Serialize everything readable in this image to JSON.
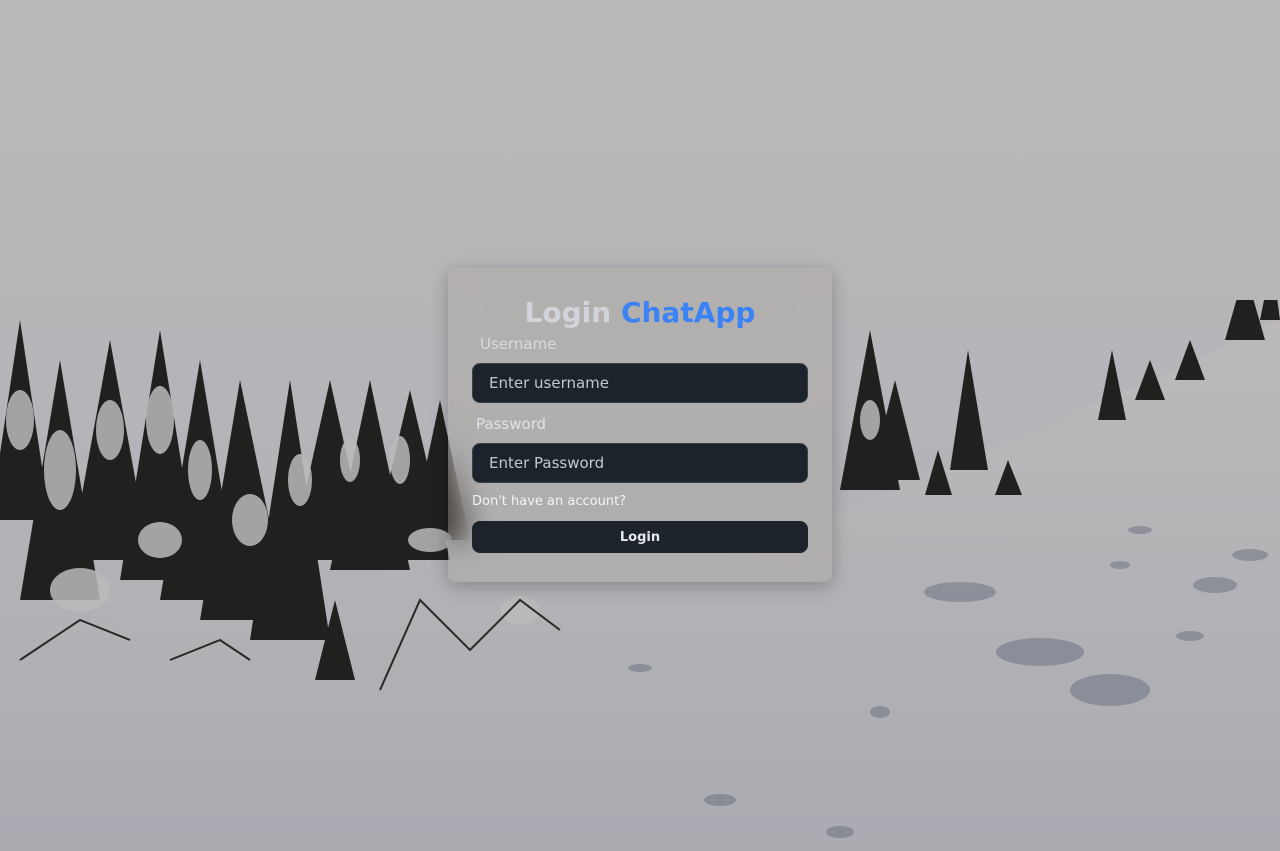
{
  "login": {
    "title_prefix": "Login",
    "title_brand": "ChatApp",
    "username_label": "Username",
    "username_placeholder": "Enter username",
    "username_value": "",
    "password_label": "Password",
    "password_placeholder": "Enter Password",
    "password_value": "",
    "signup_link": "Don't have an account?",
    "submit_label": "Login"
  },
  "colors": {
    "brand": "#3b82f6",
    "title_text": "#d1d5db",
    "input_bg": "#1d232a",
    "button_bg": "#1d232a"
  }
}
